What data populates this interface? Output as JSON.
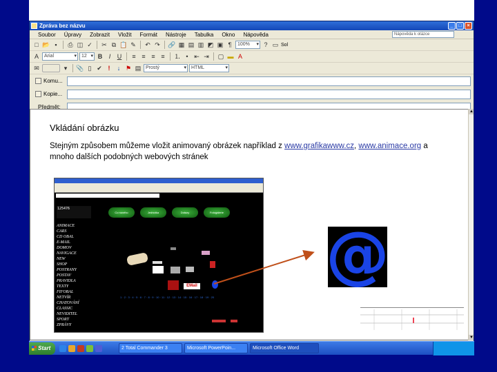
{
  "window": {
    "title": "Zpráva bez názvu",
    "menu": [
      "Soubor",
      "Úpravy",
      "Zobrazit",
      "Vložit",
      "Formát",
      "Nástroje",
      "Tabulka",
      "Okno",
      "Nápověda"
    ],
    "help_placeholder": "Nápověda k otázce",
    "zoom": "100%",
    "font_name": "Arial",
    "font_size": "12",
    "format_value": "Prostý",
    "html_value": "HTML",
    "status_left": "Sol"
  },
  "headers": {
    "to_label": "Komu...",
    "cc_label": "Kopie...",
    "subject_label": "Předmět:"
  },
  "content": {
    "heading": "Vkládání obrázku",
    "para_text1": "Stejným způsobem můžeme vložit animovaný obrázek například z ",
    "link1": "www.grafikawww.cz",
    "para_text2": ", ",
    "link2": "www.animace.org",
    "para_text3": " a mnoho dalších podobných webových stránek"
  },
  "screenshot": {
    "counter": "125476",
    "nav": [
      "Co nového",
      "Jednotka",
      "Dotazy",
      "Fotogalerie"
    ],
    "categories": [
      "ANIMACE",
      "CARS",
      "CD OBAL",
      "E-MAIL",
      "DOMOV",
      "NAVIGACE",
      "NEW",
      "SHOP",
      "POSTRANY",
      "POSTAV",
      "PRAVIDLA",
      "TEXTY",
      "FIFOBAL",
      "NETVÍR",
      "CHATOVÁNÍ",
      "CLASSIC",
      "NEVIDITEL",
      "SPORT",
      "ZPRÁVY"
    ],
    "email_sign": "EMail"
  },
  "taskbar": {
    "start_label": "Start",
    "tasks": [
      "2 Total Commander 3",
      "Microsoft PowerPoin...",
      "Microsoft Office Word"
    ],
    "active_task": "Microsoft Office Word"
  },
  "colors": {
    "slide_blue": "#000a8a",
    "link": "#2a3aa5",
    "at_blue": "#1a44e6",
    "arrow": "#c0501a"
  }
}
